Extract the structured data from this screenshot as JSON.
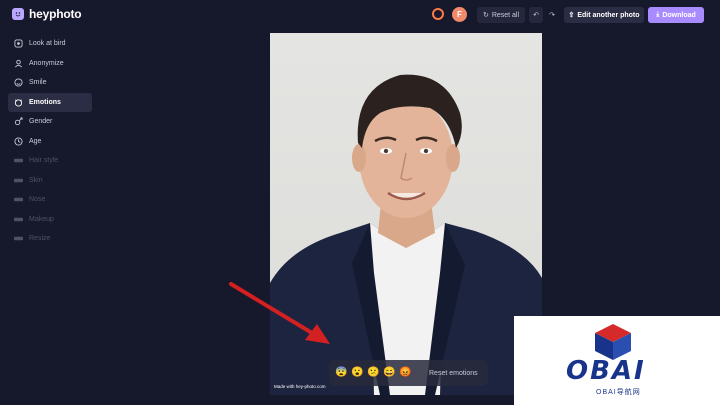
{
  "app": {
    "name": "heyphoto"
  },
  "topbar": {
    "avatar_initial": "F",
    "reset_all_label": "Reset all",
    "edit_another_label": "Edit another photo",
    "download_label": "Download"
  },
  "sidebar": {
    "items": [
      {
        "label": "Look at bird",
        "icon": "eye-icon",
        "state": "normal"
      },
      {
        "label": "Anonymize",
        "icon": "user-mask-icon",
        "state": "normal"
      },
      {
        "label": "Smile",
        "icon": "smile-icon",
        "state": "normal"
      },
      {
        "label": "Emotions",
        "icon": "emotions-icon",
        "state": "active"
      },
      {
        "label": "Gender",
        "icon": "gender-icon",
        "state": "normal"
      },
      {
        "label": "Age",
        "icon": "age-icon",
        "state": "normal"
      },
      {
        "label": "Hair style",
        "icon": "locked-icon",
        "state": "disabled"
      },
      {
        "label": "Skin",
        "icon": "locked-icon",
        "state": "disabled"
      },
      {
        "label": "Nose",
        "icon": "locked-icon",
        "state": "disabled"
      },
      {
        "label": "Makeup",
        "icon": "locked-icon",
        "state": "disabled"
      },
      {
        "label": "Resize",
        "icon": "locked-icon",
        "state": "disabled"
      }
    ]
  },
  "photo": {
    "watermark": "Made with hey-photo.com"
  },
  "emotions": {
    "emojis": [
      "😨",
      "😮",
      "😕",
      "😄",
      "😡"
    ],
    "reset_label": "Reset emotions"
  },
  "overlay": {
    "brand": "OBAI",
    "brand_sub": "OBAI导航网"
  },
  "colors": {
    "accent": "#a88cff",
    "background": "#16182b",
    "arrow": "#d32020",
    "brand": "#17348a"
  }
}
